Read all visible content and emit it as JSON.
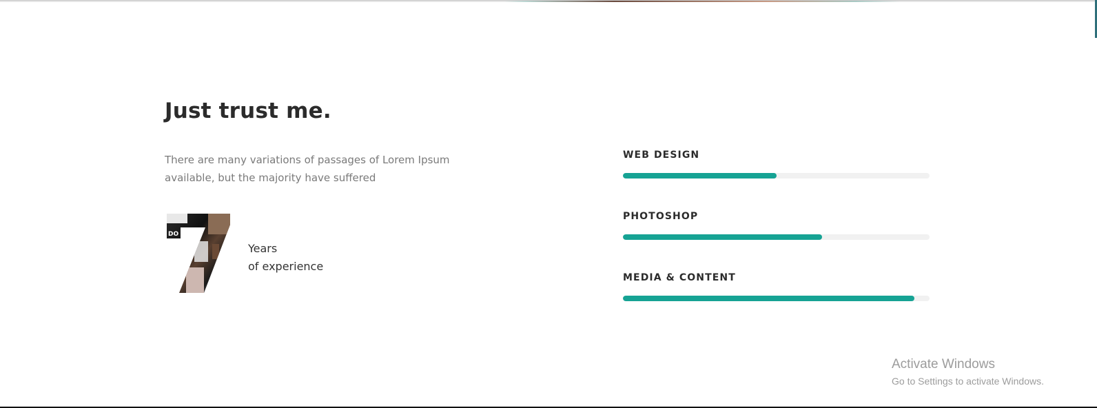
{
  "section": {
    "title": "Just trust me.",
    "intro": "There are many variations of passages of Lorem Ipsum available, but the majority have suffered"
  },
  "experience": {
    "number": "7",
    "image_overlay_text": "DO",
    "line1": "Years",
    "line2": "of experience"
  },
  "skills": [
    {
      "label": "WEB DESIGN",
      "percent": 50
    },
    {
      "label": "PHOTOSHOP",
      "percent": 65
    },
    {
      "label": "MEDIA & CONTENT",
      "percent": 95
    }
  ],
  "colors": {
    "accent": "#16a394",
    "track": "#f1f1f1",
    "heading": "#2b2b2b",
    "body_text": "#7a7a7a"
  },
  "os_overlay": {
    "title": "Activate Windows",
    "subtitle": "Go to Settings to activate Windows."
  }
}
